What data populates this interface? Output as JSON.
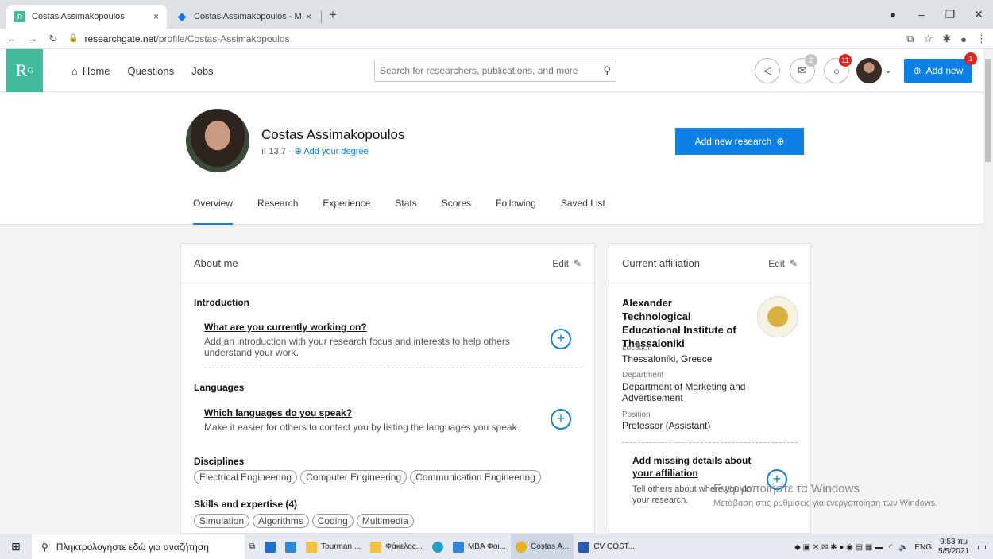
{
  "browser": {
    "tabs": [
      {
        "title": "Costas Assimakopoulos",
        "close": "×"
      },
      {
        "title": "Costas Assimakopoulos - Μελετ",
        "close": "×"
      }
    ],
    "new_tab": "+",
    "url_host": "researchgate.net",
    "url_path": "/profile/Costas-Assimakopoulos"
  },
  "header": {
    "logo": "R",
    "logo_sup": "G",
    "nav": {
      "home": "Home",
      "questions": "Questions",
      "jobs": "Jobs"
    },
    "search_placeholder": "Search for researchers, publications, and more",
    "messages_badge": "2",
    "notifications_badge": "11",
    "add_new_label": "Add new",
    "add_new_badge": "1"
  },
  "profile": {
    "name": "Costas Assimakopoulos",
    "score": "13.7 ·",
    "add_degree": "Add your degree",
    "add_research": "Add new research",
    "tabs": [
      "Overview",
      "Research",
      "Experience",
      "Stats",
      "Scores",
      "Following",
      "Saved List"
    ]
  },
  "about": {
    "title": "About me",
    "edit": "Edit",
    "introduction_heading": "Introduction",
    "intro_question": "What are you currently working on?",
    "intro_desc": "Add an introduction with your research focus and interests to help others understand your work.",
    "languages_heading": "Languages",
    "lang_question": "Which languages do you speak?",
    "lang_desc": "Make it easier for others to contact you by listing the languages you speak.",
    "disciplines_heading": "Disciplines",
    "disciplines": [
      "Electrical Engineering",
      "Computer Engineering",
      "Communication Engineering"
    ],
    "skills_heading": "Skills and expertise (4)",
    "skills": [
      "Simulation",
      "Algorithms",
      "Coding",
      "Multimedia"
    ]
  },
  "affiliation": {
    "title": "Current affiliation",
    "edit": "Edit",
    "institution": "Alexander Technological Educational Institute of Thessaloniki",
    "location_label": "Location",
    "location": "Thessaloníki, Greece",
    "department_label": "Department",
    "department": "Department of Marketing and Advertisement",
    "position_label": "Position",
    "position": "Professor (Assistant)",
    "missing_title": "Add missing details about your affiliation",
    "missing_desc": "Tell others about where you do your research."
  },
  "watermark": {
    "line1": "Ενεργοποιήστε τα Windows",
    "line2": "Μετάβαση στις ρυθμίσεις για ενεργοποίηση των Windows."
  },
  "taskbar": {
    "search_text": "Πληκτρολογήστε εδώ για αναζήτηση",
    "apps": [
      "Tourman ...",
      "Φάκελος...",
      "MBA Φοι...",
      "Costas A...",
      "CV COST..."
    ],
    "lang": "ENG",
    "time": "9:53 πμ",
    "date": "5/5/2021"
  },
  "colors": {
    "brand": "#40ba9b",
    "accent": "#0e80e3",
    "badge_red": "#e0241f"
  }
}
